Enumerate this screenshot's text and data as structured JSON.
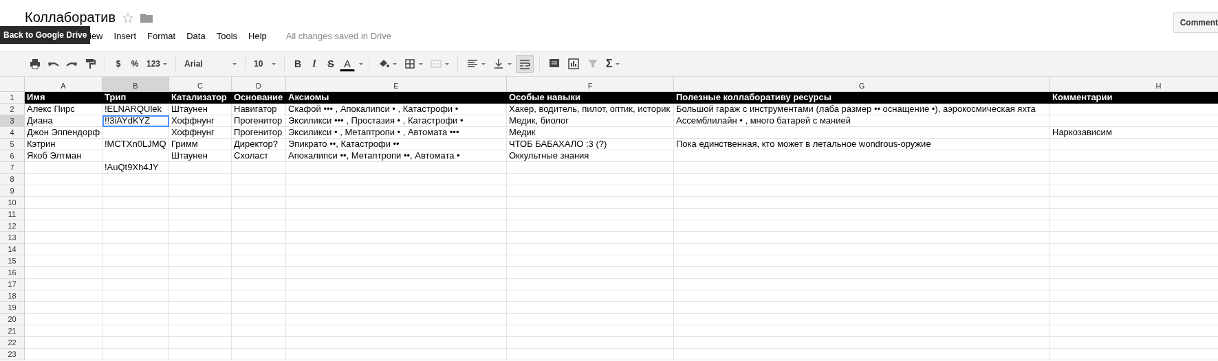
{
  "document": {
    "title": "Коллаборатив",
    "starred": false
  },
  "tooltip": "Back to Google Drive",
  "menu": [
    "iew",
    "Insert",
    "Format",
    "Data",
    "Tools",
    "Help"
  ],
  "save_status": "All changes saved in Drive",
  "comments_button": "Comment",
  "toolbar": {
    "currency": "$",
    "percent": "%",
    "number_format": "123",
    "font": "Arial",
    "font_size": "10",
    "bold": "B",
    "italic": "I",
    "strikethrough": "S",
    "text_color": "A",
    "functions": "Σ",
    "wrap_text_on": true
  },
  "columns": [
    {
      "label": "A",
      "selected": false
    },
    {
      "label": "B",
      "selected": true
    },
    {
      "label": "C",
      "selected": false
    },
    {
      "label": "D",
      "selected": false
    },
    {
      "label": "E",
      "selected": false
    },
    {
      "label": "F",
      "selected": false
    },
    {
      "label": "G",
      "selected": false
    },
    {
      "label": "H",
      "selected": false
    }
  ],
  "rows": [
    {
      "number": "1",
      "kind": "header",
      "selected": false,
      "cells": {
        "A": "Имя",
        "B": "Трип",
        "C": "Катализатор",
        "D": "Основание",
        "E": "Аксиомы",
        "F": "Особые навыки",
        "G": "Полезные коллаборативу ресурсы",
        "H": "Комментарии"
      }
    },
    {
      "number": "2",
      "kind": "data",
      "selected": false,
      "cells": {
        "A": "Алекс Пирс",
        "B": "!ELNARQUlek",
        "C": "Штаунен",
        "D": "Навигатор",
        "E": "Скафой ••• , Апокалипси • , Катастрофи •",
        "F": "Хакер, водитель, пилот, оптик, историк",
        "G": "Большой гараж с инструментами (лаба размер •• оснащение •), аэрокосмическая яхта"
      }
    },
    {
      "number": "3",
      "kind": "data",
      "selected": true,
      "cells": {
        "A": "Диана",
        "B": "!!3iAYdKYZ",
        "C": "Хоффнунг",
        "D": "Прогенитор",
        "E": "Эксиликси ••• , Простазия • , Катастрофи •",
        "F": "Медик, биолог",
        "G": "Ассемблилайн • , много батарей с манией"
      }
    },
    {
      "number": "4",
      "kind": "data",
      "selected": false,
      "cells": {
        "A": "Джон Эппендорф",
        "C": "Хоффнунг",
        "D": "Прогенитор",
        "E": "Эксиликси • , Метаптропи • , Автомата •••",
        "F": "Медик",
        "H": "Наркозависим"
      }
    },
    {
      "number": "5",
      "kind": "data",
      "selected": false,
      "cells": {
        "A": "Кэтрин",
        "B": "!MCTXn0LJMQ",
        "C": "Гримм",
        "D": "Директор?",
        "E": "Эпикрато ••, Катастрофи ••",
        "F": "ЧТОБ БАБАХАЛО :3 (?)",
        "G": "Пока единственная, кто может в летальное wondrous-оружие"
      }
    },
    {
      "number": "6",
      "kind": "data",
      "selected": false,
      "cells": {
        "A": "Якоб Элтман",
        "C": "Штаунен",
        "D": "Схоласт",
        "E": "Апокалипси ••, Метаптропи ••, Автомата •",
        "F": "Оккультные знания"
      }
    },
    {
      "number": "7",
      "kind": "data",
      "selected": false,
      "cells": {
        "B": "!AuQt9Xh4JY"
      }
    },
    {
      "number": "8",
      "kind": "data",
      "selected": false
    },
    {
      "number": "9",
      "kind": "data",
      "selected": false
    },
    {
      "number": "10",
      "kind": "data",
      "selected": false
    },
    {
      "number": "11",
      "kind": "data",
      "selected": false
    },
    {
      "number": "12",
      "kind": "data",
      "selected": false
    },
    {
      "number": "13",
      "kind": "data",
      "selected": false
    },
    {
      "number": "14",
      "kind": "data",
      "selected": false
    },
    {
      "number": "15",
      "kind": "data",
      "selected": false
    },
    {
      "number": "16",
      "kind": "data",
      "selected": false
    },
    {
      "number": "17",
      "kind": "data",
      "selected": false
    },
    {
      "number": "18",
      "kind": "data",
      "selected": false
    },
    {
      "number": "19",
      "kind": "data",
      "selected": false
    },
    {
      "number": "20",
      "kind": "data",
      "selected": false
    },
    {
      "number": "21",
      "kind": "data",
      "selected": false
    },
    {
      "number": "22",
      "kind": "data",
      "selected": false
    },
    {
      "number": "23",
      "kind": "data",
      "selected": false
    }
  ]
}
